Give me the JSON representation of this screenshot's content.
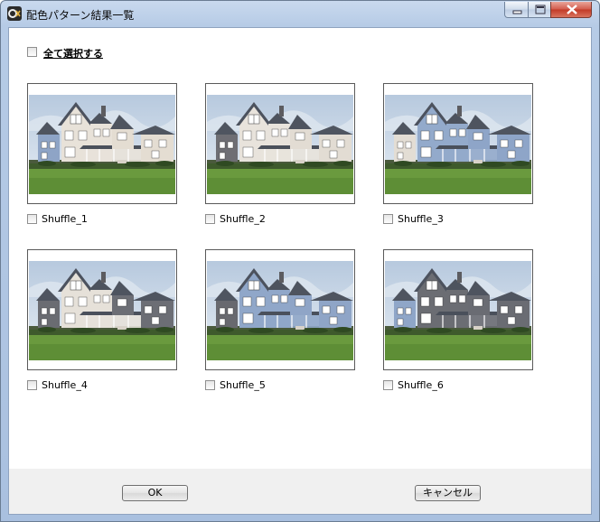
{
  "window": {
    "title": "配色パターン結果一覧",
    "icon": "app-logo-icon",
    "controls": [
      "minimize-icon",
      "maximize-icon",
      "close-icon"
    ]
  },
  "select_all": {
    "label": "全て選択する",
    "checked": false
  },
  "patterns": [
    {
      "label": "Shuffle_1",
      "checked": false,
      "colors": {
        "left": "#8ea4c6",
        "center": "#e8e2d9",
        "right": "#e4ddd2",
        "trim": "#ffffff"
      }
    },
    {
      "label": "Shuffle_2",
      "checked": false,
      "colors": {
        "left": "#6e6e74",
        "center": "#e8e3dc",
        "right": "#e2dcd3",
        "trim": "#ffffff"
      }
    },
    {
      "label": "Shuffle_3",
      "checked": false,
      "colors": {
        "left": "#e3ddd4",
        "center": "#93aacb",
        "right": "#8ea5c8",
        "trim": "#ffffff"
      }
    },
    {
      "label": "Shuffle_4",
      "checked": false,
      "colors": {
        "left": "#6a6c72",
        "center": "#e6e1d9",
        "right": "#6c6e75",
        "trim": "#ffffff"
      }
    },
    {
      "label": "Shuffle_5",
      "checked": false,
      "colors": {
        "left": "#68696f",
        "center": "#90a7c9",
        "right": "#8fa5c7",
        "trim": "#ffffff"
      }
    },
    {
      "label": "Shuffle_6",
      "checked": false,
      "colors": {
        "left": "#8fa6c8",
        "center": "#6b6d73",
        "right": "#6a6c73",
        "trim": "#ffffff"
      }
    }
  ],
  "buttons": {
    "ok": "OK",
    "cancel": "キャンセル"
  }
}
